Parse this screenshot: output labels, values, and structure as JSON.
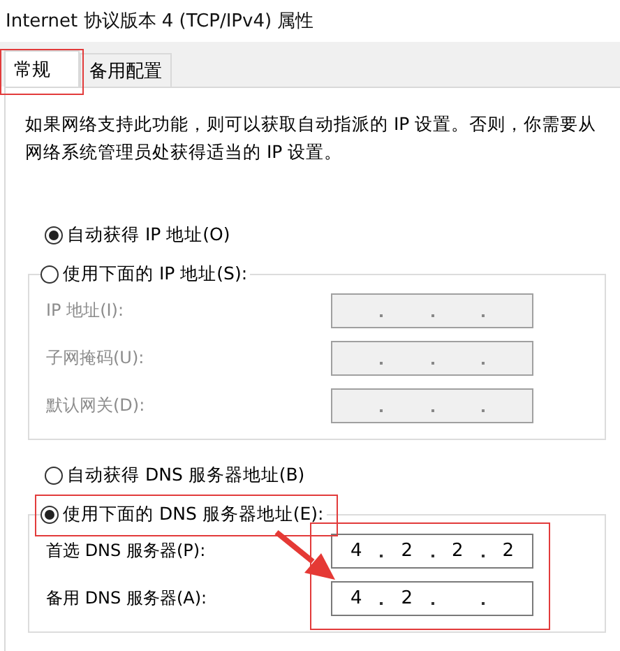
{
  "window": {
    "title": "Internet 协议版本 4 (TCP/IPv4) 属性"
  },
  "tabs": [
    {
      "label": "常规",
      "selected": true,
      "highlighted": true
    },
    {
      "label": "备用配置",
      "selected": false,
      "highlighted": false
    }
  ],
  "description": "如果网络支持此功能，则可以获取自动指派的 IP 设置。否则，你需要从网络系统管理员处获得适当的 IP 设置。",
  "ip_mode": [
    {
      "label": "自动获得 IP 地址(O)",
      "selected": true
    },
    {
      "label": "使用下面的 IP 地址(S):",
      "selected": false
    }
  ],
  "ip_settings": {
    "disabled": true,
    "fields": [
      {
        "label": "IP 地址(I):"
      },
      {
        "label": "子网掩码(U):"
      },
      {
        "label": "默认网关(D):"
      }
    ]
  },
  "dns_mode": [
    {
      "label": "自动获得 DNS 服务器地址(B)",
      "selected": false,
      "highlighted": false
    },
    {
      "label": "使用下面的 DNS 服务器地址(E):",
      "selected": true,
      "highlighted": true
    }
  ],
  "dns_settings": {
    "disabled": false,
    "highlighted": true,
    "fields": [
      {
        "label": "首选 DNS 服务器(P):",
        "octets": [
          "4",
          "2",
          "2",
          "2"
        ]
      },
      {
        "label": "备用 DNS 服务器(A):",
        "octets": [
          "4",
          "2"
        ]
      }
    ]
  },
  "annotation_arrow": true
}
